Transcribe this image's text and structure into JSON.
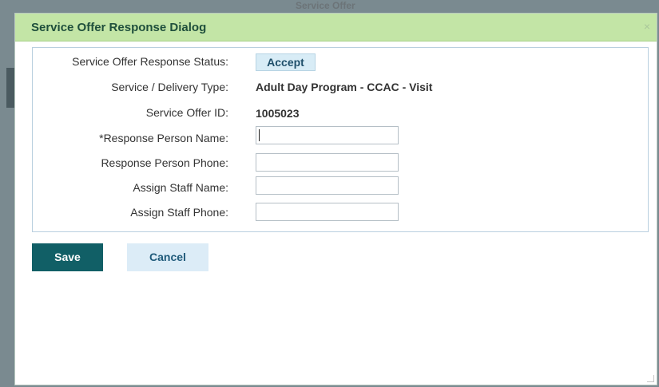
{
  "backdrop": {
    "title_fragment": "Service Offer"
  },
  "dialog": {
    "title": "Service Offer Response Dialog",
    "close_icon": "×"
  },
  "form": {
    "status_label": "Service Offer Response Status:",
    "status_value": "Accept",
    "delivery_type_label": "Service / Delivery Type:",
    "delivery_type_value": "Adult Day Program - CCAC - Visit",
    "offer_id_label": "Service Offer ID:",
    "offer_id_value": "1005023",
    "response_name_label": "*Response Person Name:",
    "response_name_value": "",
    "response_phone_label": "Response Person Phone:",
    "response_phone_value": "",
    "staff_name_label": "Assign Staff Name:",
    "staff_name_value": "",
    "staff_phone_label": "Assign Staff Phone:",
    "staff_phone_value": ""
  },
  "buttons": {
    "save": "Save",
    "cancel": "Cancel"
  },
  "colors": {
    "titlebar": "#c3e5a6",
    "title_text": "#1f4f3c",
    "save_button": "#115f66",
    "cancel_button": "#dcecf7",
    "panel_border": "#b9cfdf"
  },
  "icons": {
    "close": "close-icon",
    "resize": "resize-grip-icon"
  }
}
